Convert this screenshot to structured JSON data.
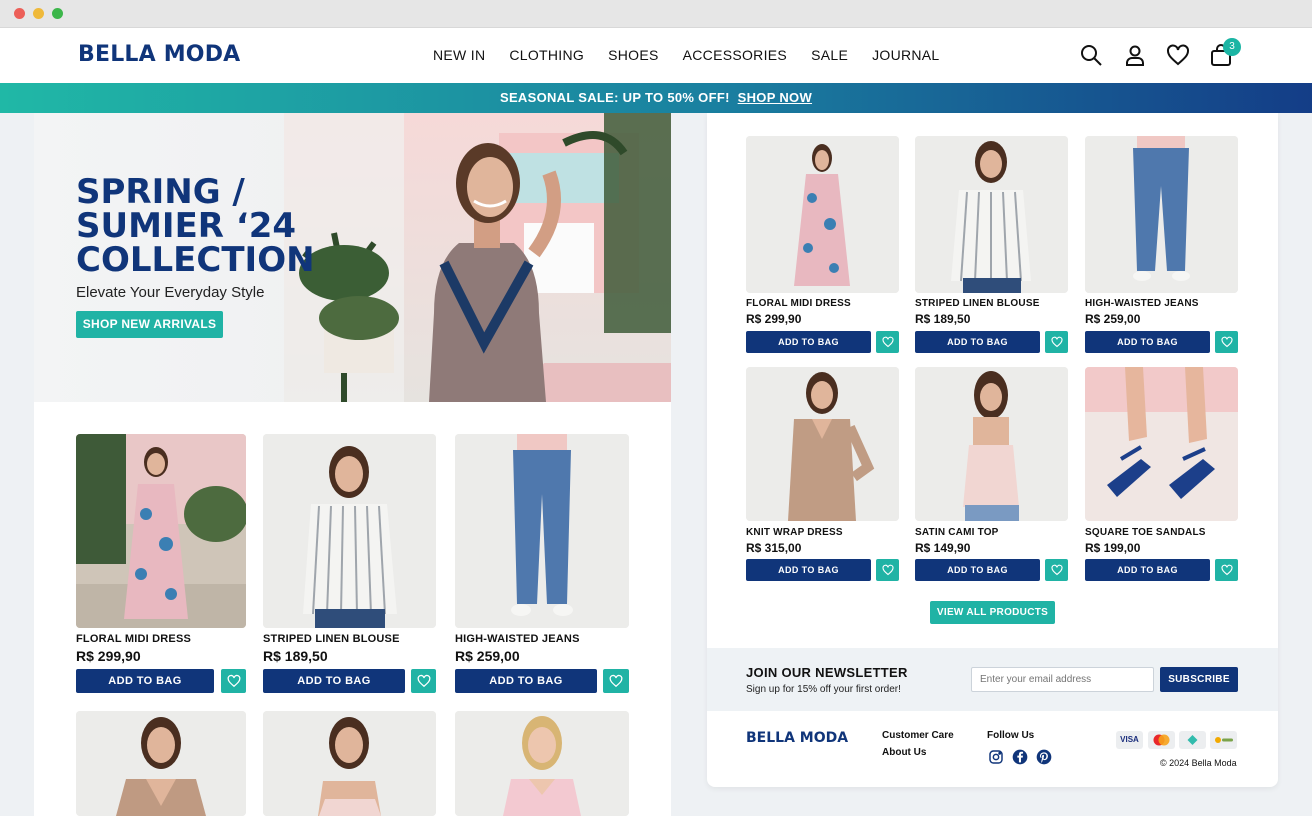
{
  "brand": {
    "name": "BELLA MODA",
    "primary": "#10357a",
    "accent": "#20b3a5"
  },
  "nav": {
    "items": [
      "NEW IN",
      "CLOTHING",
      "SHOES",
      "ACCESSORIES",
      "SALE",
      "JOURNAL"
    ],
    "cart_count": "3",
    "icons": [
      "search-icon",
      "account-icon",
      "wishlist-heart-icon",
      "shopping-bag-icon"
    ]
  },
  "promo": {
    "text": "SEASONAL SALE: UP TO 50% OFF!",
    "link": "SHOP NOW"
  },
  "hero": {
    "title": "SPRING /\nSUMIER ‘24\nCOLLECTION",
    "subtitle": "Elevate Your Everyday Style",
    "cta": "SHOP NEW ARRIVALS"
  },
  "add_to_bag_label": "ADD TO BAG",
  "left_products": [
    {
      "name": "FLORAL MIDI DRESS",
      "price": "R$ 299,90"
    },
    {
      "name": "STRIPED LINEN BLOUSE",
      "price": "R$ 189,50"
    },
    {
      "name": "HIGH-WAISTED JEANS",
      "price": "R$ 259,00"
    },
    {
      "name": "",
      "price": ""
    },
    {
      "name": "",
      "price": ""
    },
    {
      "name": "",
      "price": ""
    }
  ],
  "right_products": [
    {
      "name": "FLORAL MIDI DRESS",
      "price": "R$ 299,90"
    },
    {
      "name": "STRIPED LINEN BLOUSE",
      "price": "R$ 189,50"
    },
    {
      "name": "HIGH-WAISTED JEANS",
      "price": "R$ 259,00"
    },
    {
      "name": "KNIT WRAP DRESS",
      "price": "R$ 315,00"
    },
    {
      "name": "SATIN CAMI TOP",
      "price": "R$ 149,90"
    },
    {
      "name": "SQUARE TOE SANDALS",
      "price": "R$ 199,00"
    }
  ],
  "view_all": "VIEW ALL PRODUCTS",
  "newsletter": {
    "title": "JOIN OUR NEWSLETTER",
    "subtitle": "Sign up for 15% off your first order!",
    "placeholder": "Enter your email address",
    "button": "SUBSCRIBE"
  },
  "footer": {
    "logo": "BELLA MODA",
    "links": [
      "Customer Care",
      "About Us"
    ],
    "follow_label": "Follow Us",
    "social": [
      "instagram-icon",
      "facebook-icon",
      "pinterest-icon"
    ],
    "payments": [
      "VISA",
      "mastercard",
      "pix",
      "pagseguro"
    ],
    "visa_label": "VISA",
    "copyright": "© 2024 Bella Moda"
  }
}
